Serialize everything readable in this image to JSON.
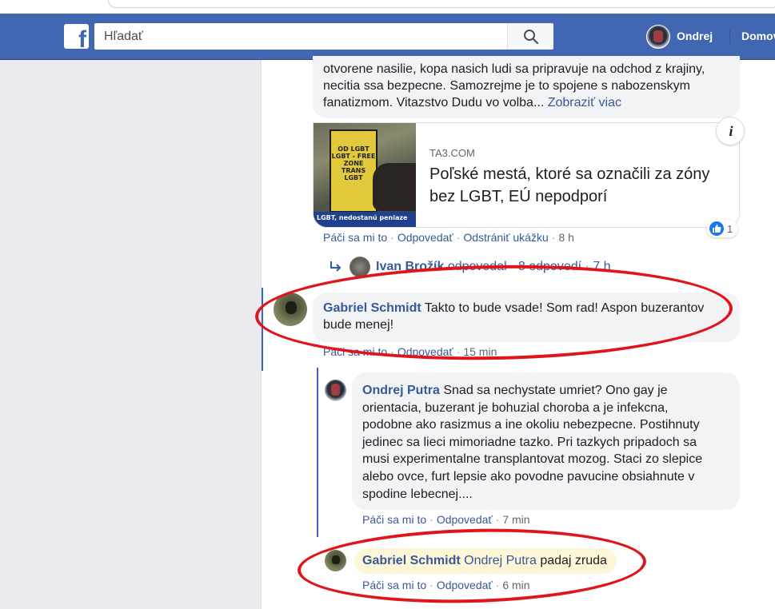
{
  "topbar": {
    "search_placeholder": "Hľadať",
    "user_name": "Ondrej",
    "home_label": "Domov",
    "logo": "facebook-f-logo"
  },
  "post_preview": {
    "line1": "otvorene nasilie, kopa nasich ludi sa pripravuje na odchod z krajiny,",
    "line2": "necitia ssa bezpecne. Samozrejme je to spojene s nabozenskym",
    "line3_text": "fanatizmom. Vitazstvo Dudu vo volba...",
    "see_more": "Zobraziť viac"
  },
  "link_card": {
    "domain": "TA3.COM",
    "title": "Poľské mestá, ktoré sa označili za zóny bez LGBT, EÚ nepodporí",
    "thumb_sign": "OD LGBT\nLGBT - FREE ZONE\nTRANS LGBT",
    "thumb_banner": "LGBT, nedostanú peniaze",
    "info_glyph": "i",
    "reaction_count": "1"
  },
  "actions_1": {
    "like": "Páči sa mi to",
    "reply": "Odpovedať",
    "remove_preview": "Odstrániť ukážku",
    "time": "8 h"
  },
  "ivan_reply": {
    "name": "Ivan Brožík",
    "text": "odpovedal",
    "replies": "8 odpovedí",
    "time": "7 h"
  },
  "comment_gabriel_1": {
    "name": "Gabriel Schmidt",
    "text_line1": "Takto to bude vsade! Som rad! Aspon buzerantov",
    "text_line2": "bude menej!",
    "like": "Páči sa mi to",
    "reply": "Odpovedať",
    "time": "15 min"
  },
  "comment_ondrej": {
    "name": "Ondrej Putra",
    "lines": [
      "Snad sa nechystate umriet? Ono gay je",
      "orientacia, buzerant je bohuzial choroba a je infekcna,",
      "podobne ako rasizmus a ine okoliu nebezpecne. Postihnuty",
      "jedinec sa lieci mimoriadne tazko. Pri tazkych pripadoch sa",
      "musi experimentalne transplantovat mozog. Staci zo slepice",
      "alebo ovce, furt lepsie ako povodne pavucine obsiahnute v",
      "spodine lebecnej...."
    ],
    "like": "Páči sa mi to",
    "reply": "Odpovedať",
    "time": "7 min"
  },
  "comment_gabriel_2": {
    "name": "Gabriel Schmidt",
    "mention": "Ondrej Putra",
    "text": "padaj zruda",
    "like": "Páči sa mi to",
    "reply": "Odpovedať",
    "time": "6 min"
  },
  "colors": {
    "facebook_blue": "#4267b2",
    "link_blue": "#385898",
    "annotation_red": "#e0141b",
    "bubble_gray": "#f2f3f5"
  }
}
